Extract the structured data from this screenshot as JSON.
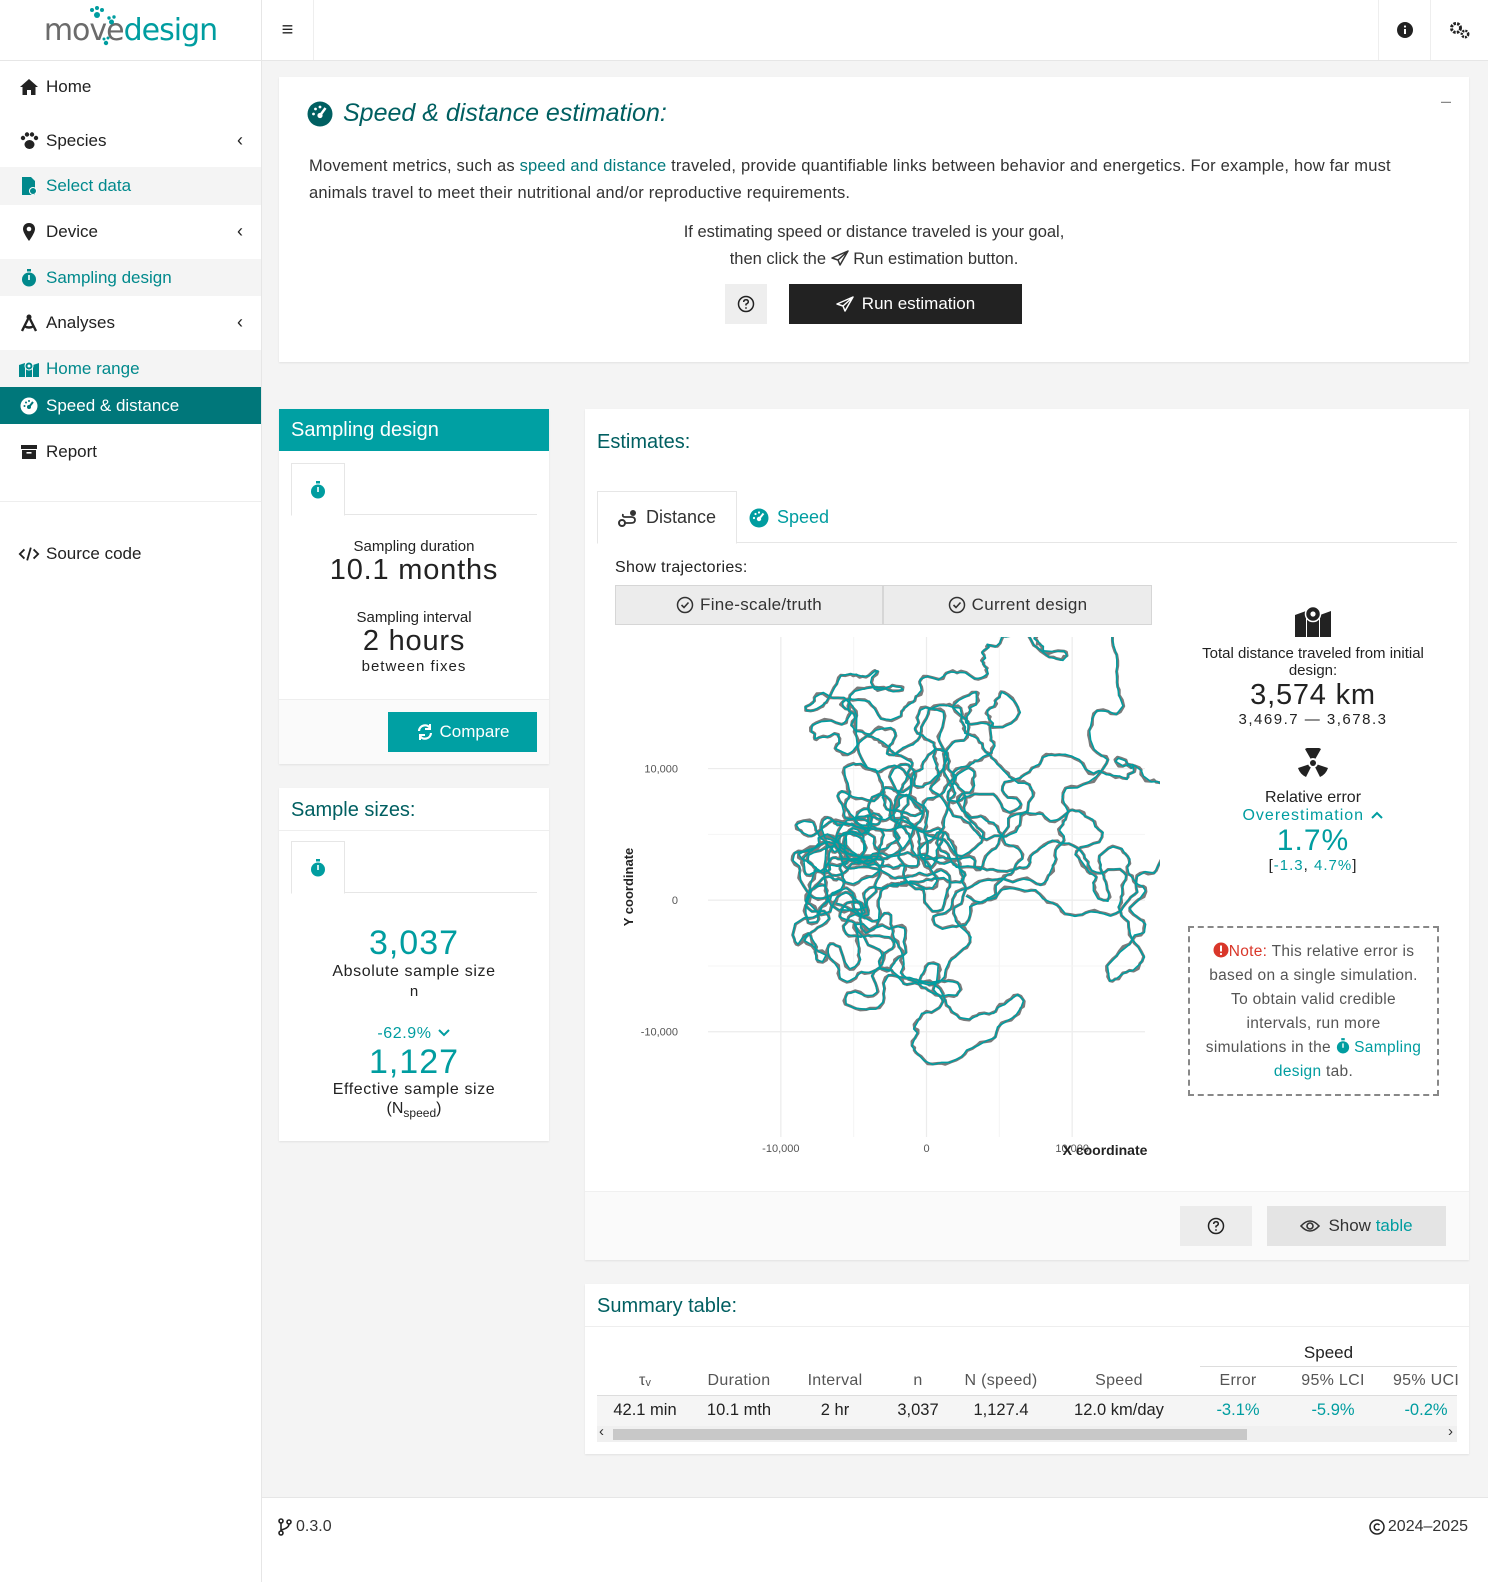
{
  "logo": {
    "part1": "move",
    "part2": "design"
  },
  "sidebar": {
    "items": [
      {
        "label": "Home",
        "icon": "home-icon"
      },
      {
        "label": "Species",
        "icon": "paw-icon"
      },
      {
        "label": "Select data",
        "icon": "file-icon"
      },
      {
        "label": "Device",
        "icon": "map-pin-icon"
      },
      {
        "label": "Sampling design",
        "icon": "stopwatch-icon"
      },
      {
        "label": "Analyses",
        "icon": "compass-icon"
      },
      {
        "label": "Home range",
        "icon": "map-icon"
      },
      {
        "label": "Speed & distance",
        "icon": "gauge-icon"
      },
      {
        "label": "Report",
        "icon": "archive-icon"
      },
      {
        "label": "Source code",
        "icon": "code-icon"
      }
    ]
  },
  "intro": {
    "title": "Speed & distance estimation:",
    "text_before": "Movement metrics, such as ",
    "text_link": "speed and distance",
    "text_after": " traveled, provide quantifiable links between behavior and energetics. For example, how far must animals travel to meet their nutritional and/or reproductive requirements.",
    "goal_line1": "If estimating speed or distance traveled is your goal,",
    "goal_line2a": "then click the ",
    "goal_line2b": "Run estimation button.",
    "run_button": "Run estimation",
    "collapse": "–"
  },
  "sampling": {
    "title": "Sampling design",
    "duration_label": "Sampling duration",
    "duration_value": "10.1 months",
    "interval_label": "Sampling interval",
    "interval_value": "2 hours",
    "interval_sub": "between fixes",
    "compare_button": "Compare"
  },
  "sample_sizes": {
    "title": "Sample sizes:",
    "absolute_value": "3,037",
    "absolute_label": "Absolute sample size",
    "absolute_sub": "n",
    "change": "-62.9%",
    "effective_value": "1,127",
    "effective_label": "Effective sample size",
    "effective_sub_n": "N",
    "effective_sub_speed": "speed"
  },
  "estimates": {
    "title": "Estimates:",
    "tabs": [
      {
        "label": "Distance"
      },
      {
        "label": "Speed"
      }
    ],
    "show_trajectories": "Show trajectories:",
    "toggle_truth": "Fine-scale/truth",
    "toggle_current": "Current design",
    "total_label": "Total distance traveled from initial design:",
    "total_value": "3,574 km",
    "total_ci": "3,469.7 — 3,678.3",
    "relerr_label": "Relative error",
    "relerr_dir": "Overestimation",
    "relerr_value": "1.7%",
    "relerr_ci_open": "[",
    "relerr_ci_low": "-1.3",
    "relerr_ci_sep": ", ",
    "relerr_ci_high": "4.7%",
    "relerr_ci_close": "]",
    "note_label": "Note:",
    "note_text": " This relative error is based on a single simulation. To obtain valid credible intervals, run more simulations in the ",
    "note_link": "Sampling design",
    "note_end": " tab.",
    "show_table_a": "Show ",
    "show_table_b": "table"
  },
  "chart_data": {
    "type": "scatter",
    "xlabel": "X coordinate",
    "ylabel": "Y coordinate",
    "xticks": [
      -10000,
      0,
      10000
    ],
    "xtick_labels": [
      "-10,000",
      "0",
      "10,000"
    ],
    "yticks": [
      10000,
      0,
      -10000
    ],
    "ytick_labels": [
      "10,000",
      "0",
      "-10,000"
    ],
    "xlim": [
      -15000,
      15000
    ],
    "ylim": [
      -18000,
      20000
    ],
    "grid": true,
    "series": [
      {
        "color": "#7a7a7a"
      },
      {
        "color": "#009da0"
      }
    ]
  },
  "summary": {
    "title": "Summary table:",
    "group_header": "Speed",
    "headers": [
      "τᵥ",
      "Duration",
      "Interval",
      "n",
      "N (speed)",
      "Speed",
      "Error",
      "95% LCI",
      "95% UCI"
    ],
    "row": [
      "42.1 min",
      "10.1 mth",
      "2 hr",
      "3,037",
      "1,127.4",
      "12.0 km/day",
      "-3.1%",
      "-5.9%",
      "-0.2%"
    ],
    "scroll_left": "‹",
    "scroll_right": "›"
  },
  "footer": {
    "version": "0.3.0",
    "copyright": "2024–2025"
  },
  "colors": {
    "accent": "#009da0",
    "dark_accent": "#005f61",
    "active_nav": "#00777a",
    "error_red": "#d9372a"
  }
}
